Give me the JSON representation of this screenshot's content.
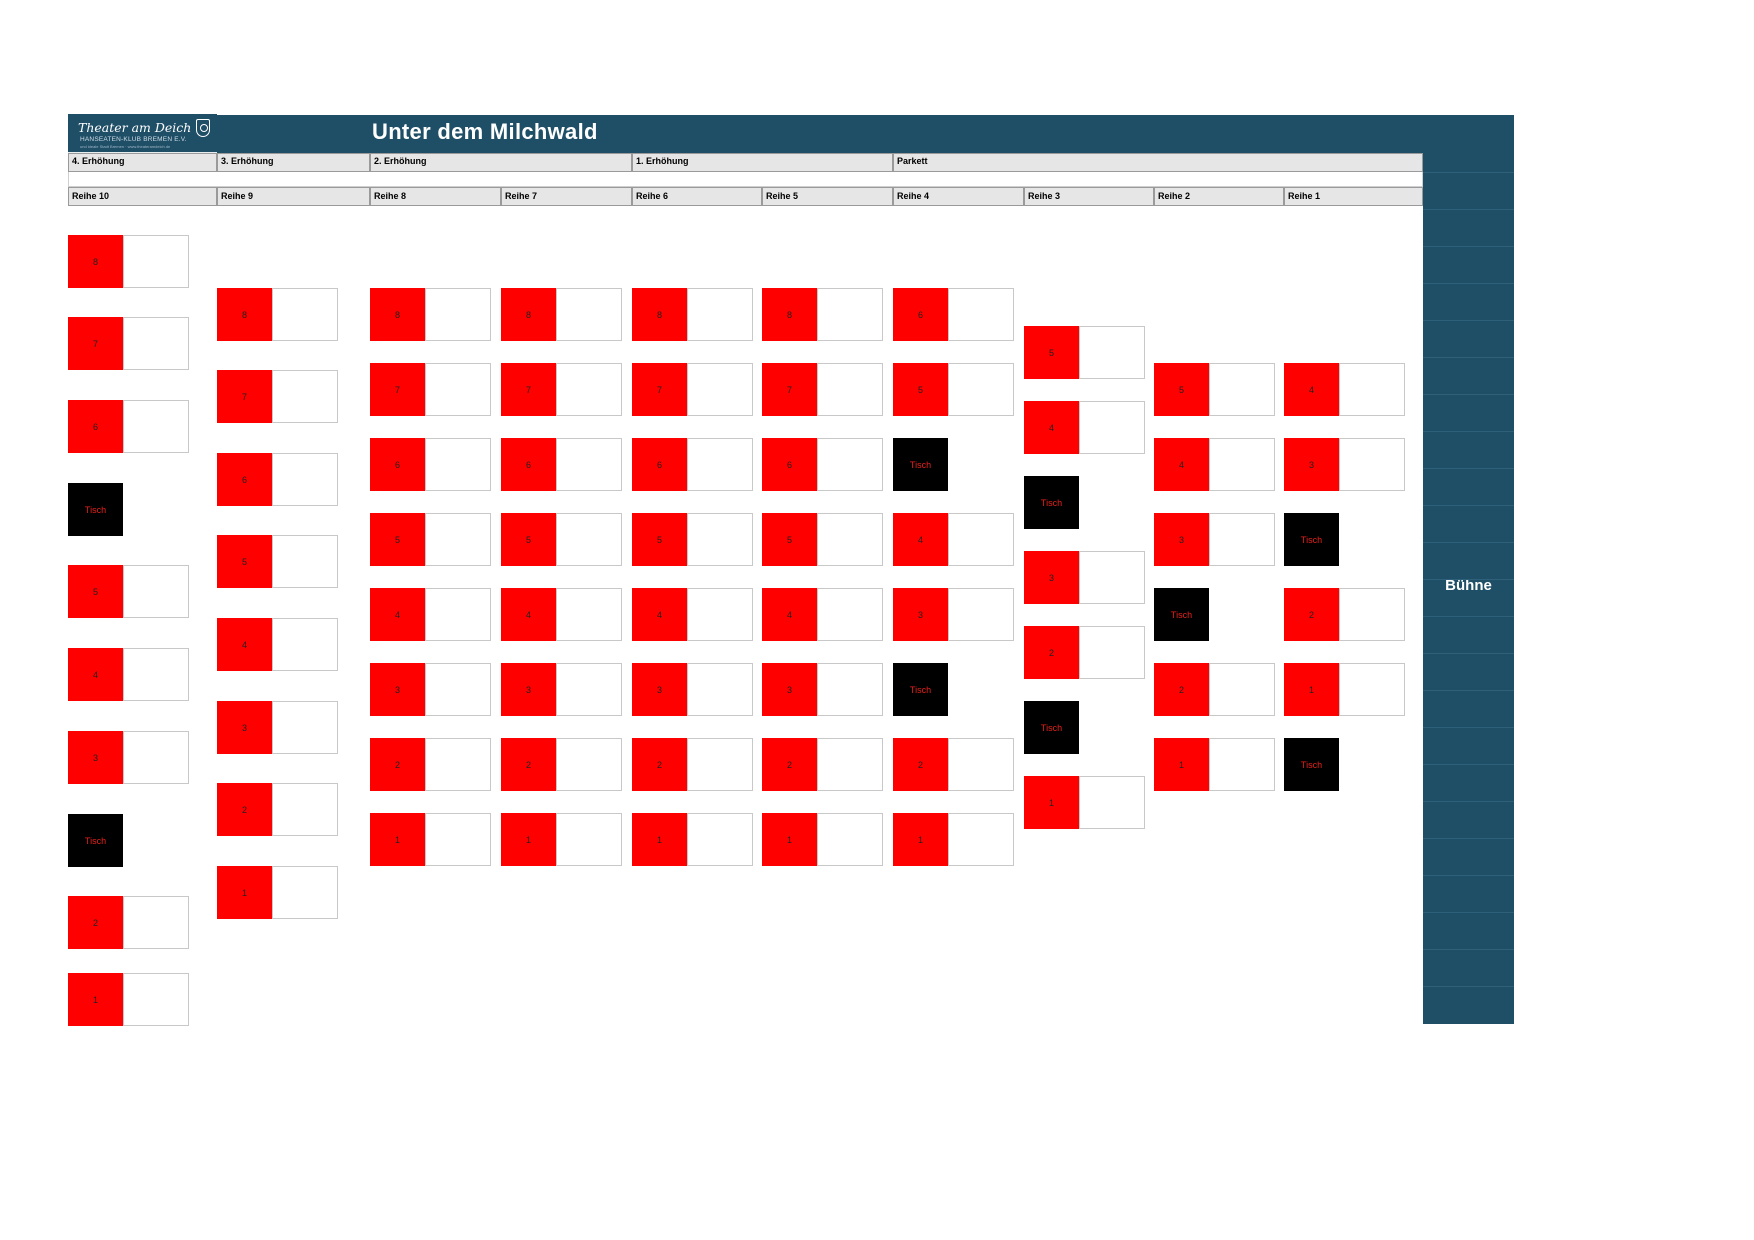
{
  "header": {
    "title": "Unter dem Milchwald",
    "logo_title": "Theater am Deich",
    "logo_subtitle": "HANSEATEN-KLUB BREMEN E.V.",
    "logo_line": "und ideale Stadt Bremen · www.theateramdeich.de",
    "stage_label": "Bühne"
  },
  "sections": [
    {
      "label": "4. Erhöhung"
    },
    {
      "label": "3. Erhöhung"
    },
    {
      "label": "2. Erhöhung"
    },
    {
      "label": "1. Erhöhung"
    },
    {
      "label": "Parkett"
    }
  ],
  "rows": [
    {
      "label": "Reihe 10",
      "seats": [
        "8",
        "7",
        "6",
        "Tisch",
        "5",
        "4",
        "3",
        "Tisch",
        "2",
        "1"
      ]
    },
    {
      "label": "Reihe 9",
      "seats": [
        "8",
        "7",
        "6",
        "5",
        "4",
        "3",
        "2",
        "1"
      ]
    },
    {
      "label": "Reihe 8",
      "seats": [
        "8",
        "7",
        "6",
        "5",
        "4",
        "3",
        "2",
        "1"
      ]
    },
    {
      "label": "Reihe 7",
      "seats": [
        "8",
        "7",
        "6",
        "5",
        "4",
        "3",
        "2",
        "1"
      ]
    },
    {
      "label": "Reihe 6",
      "seats": [
        "8",
        "7",
        "6",
        "5",
        "4",
        "3",
        "2",
        "1"
      ]
    },
    {
      "label": "Reihe 5",
      "seats": [
        "8",
        "7",
        "6",
        "5",
        "4",
        "3",
        "2",
        "1"
      ]
    },
    {
      "label": "Reihe 4",
      "seats": [
        "6",
        "5",
        "Tisch",
        "4",
        "3",
        "Tisch",
        "2",
        "1"
      ]
    },
    {
      "label": "Reihe 3",
      "seats": [
        "5",
        "4",
        "Tisch",
        "3",
        "2",
        "Tisch",
        "1"
      ]
    },
    {
      "label": "Reihe 2",
      "seats": [
        "5",
        "4",
        "3",
        "Tisch",
        "2",
        "1"
      ]
    },
    {
      "label": "Reihe 1",
      "seats": [
        "4",
        "3",
        "Tisch",
        "2",
        "1",
        "Tisch"
      ]
    }
  ],
  "tisch_label": "Tisch",
  "colors": {
    "band": "#1f4e67",
    "seat": "#fe0000",
    "table": "#000000",
    "table_text": "#e8211c"
  }
}
